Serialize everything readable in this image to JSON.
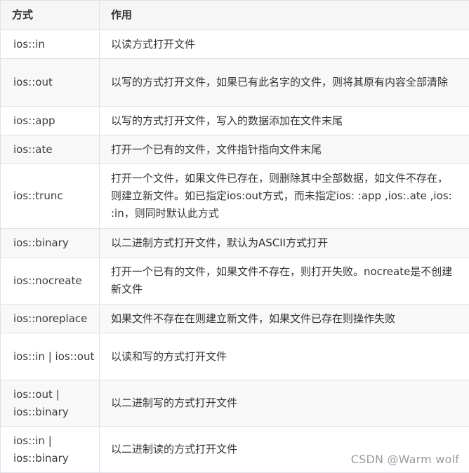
{
  "table": {
    "headers": [
      "方式",
      "作用"
    ],
    "rows": [
      {
        "mode": "ios::in",
        "desc": "以读方式打开文件"
      },
      {
        "mode": "ios::out",
        "desc": "以写的方式打开文件，如果已有此名字的文件，则将其原有内容全部清除"
      },
      {
        "mode": "ios::app",
        "desc": "以写的方式打开文件，写入的数据添加在文件末尾"
      },
      {
        "mode": "ios::ate",
        "desc": "打开一个已有的文件，文件指针指向文件末尾"
      },
      {
        "mode": "ios::trunc",
        "desc": "打开一个文件，如果文件已存在，则删除其中全部数据，如文件不存在，则建立新文件。如已指定ios:out方式，而未指定ios: :app ,ios:.ate ,ios: :in，则同时默认此方式"
      },
      {
        "mode": "ios::binary",
        "desc": "以二进制方式打开文件，默认为ASCII方式打开"
      },
      {
        "mode": "ios::nocreate",
        "desc": "打开一个已有的文件，如果文件不存在，则打开失败。nocreate是不创建新文件"
      },
      {
        "mode": "ios::noreplace",
        "desc": "如果文件不存在在则建立新文件，如果文件已存在则操作失败"
      },
      {
        "mode": "ios::in | ios::out",
        "desc": "以读和写的方式打开文件"
      },
      {
        "mode": "ios::out | ios::binary",
        "desc": "以二进制写的方式打开文件"
      },
      {
        "mode": "ios::in | ios::binary",
        "desc": "以二进制读的方式打开文件"
      }
    ]
  },
  "watermark": "CSDN @Warm wolf"
}
